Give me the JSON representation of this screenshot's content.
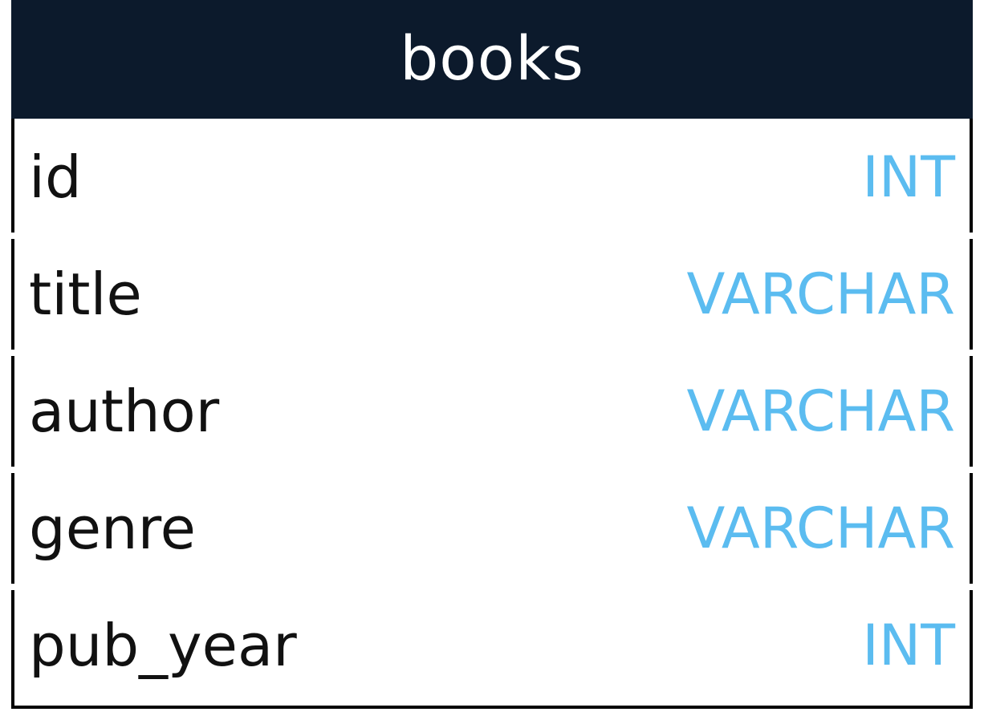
{
  "table": {
    "name": "books",
    "header_color": "#0c1a2c",
    "type_color": "#5bbcf0",
    "fields": [
      {
        "name": "id",
        "type": "INT"
      },
      {
        "name": "title",
        "type": "VARCHAR"
      },
      {
        "name": "author",
        "type": "VARCHAR"
      },
      {
        "name": "genre",
        "type": "VARCHAR"
      },
      {
        "name": "pub_year",
        "type": "INT"
      }
    ]
  }
}
